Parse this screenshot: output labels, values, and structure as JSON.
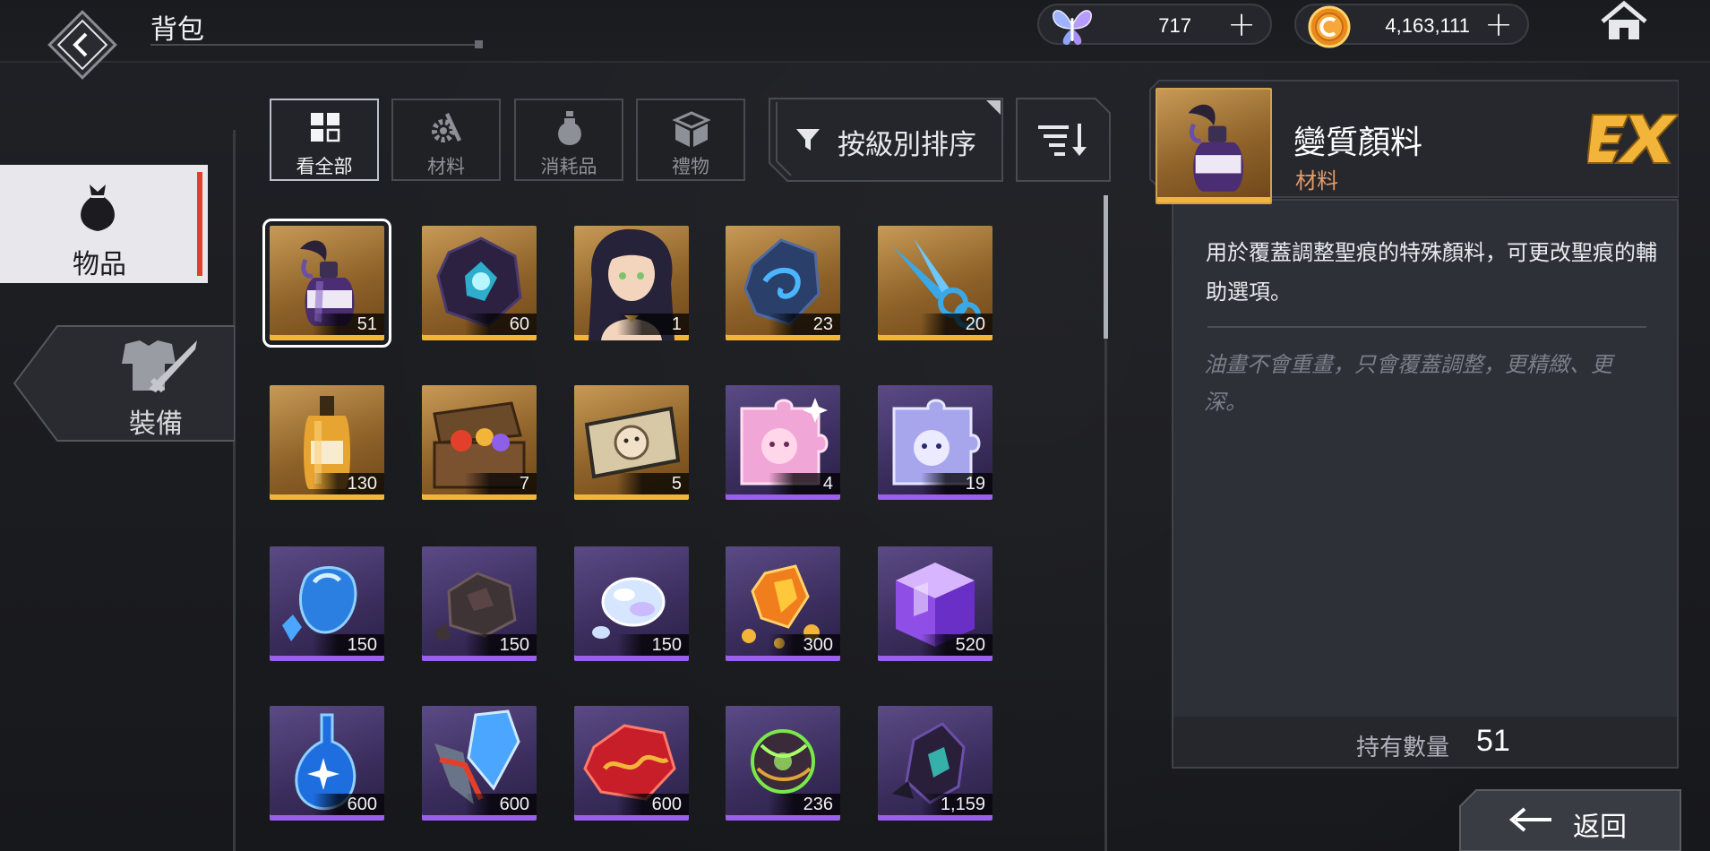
{
  "header": {
    "title": "背包",
    "currencies": [
      {
        "icon": "butterfly-icon",
        "value": "717"
      },
      {
        "icon": "gold-coin-icon",
        "value": "4,163,111"
      }
    ]
  },
  "categories": [
    {
      "label": "物品",
      "icon": "bag-icon",
      "active": true
    },
    {
      "label": "裝備",
      "icon": "armor-sword-icon",
      "active": false
    }
  ],
  "filters": [
    {
      "label": "看全部",
      "icon": "grid-icon",
      "active": true
    },
    {
      "label": "材料",
      "icon": "gear-tools-icon",
      "active": false
    },
    {
      "label": "消耗品",
      "icon": "potion-icon",
      "active": false
    },
    {
      "label": "禮物",
      "icon": "gift-box-icon",
      "active": false
    }
  ],
  "sort": {
    "label": "按級別排序"
  },
  "items": [
    {
      "count": "51",
      "rarity": "gold",
      "art": "ink-bottle"
    },
    {
      "count": "60",
      "rarity": "gold",
      "art": "dark-crystal"
    },
    {
      "count": "1",
      "rarity": "gold",
      "art": "portrait"
    },
    {
      "count": "23",
      "rarity": "gold",
      "art": "blue-stone"
    },
    {
      "count": "20",
      "rarity": "gold",
      "art": "scissors"
    },
    {
      "count": "130",
      "rarity": "gold",
      "art": "perfume"
    },
    {
      "count": "7",
      "rarity": "gold",
      "art": "chest"
    },
    {
      "count": "5",
      "rarity": "gold",
      "art": "ticket"
    },
    {
      "count": "4",
      "rarity": "purple",
      "art": "puzzle-pink"
    },
    {
      "count": "19",
      "rarity": "purple",
      "art": "puzzle-blue"
    },
    {
      "count": "150",
      "rarity": "purple",
      "art": "blue-gem"
    },
    {
      "count": "150",
      "rarity": "purple",
      "art": "ore"
    },
    {
      "count": "150",
      "rarity": "purple",
      "art": "pearl"
    },
    {
      "count": "300",
      "rarity": "purple",
      "art": "amber"
    },
    {
      "count": "520",
      "rarity": "purple",
      "art": "cube"
    },
    {
      "count": "600",
      "rarity": "purple",
      "art": "water-drop"
    },
    {
      "count": "600",
      "rarity": "purple",
      "art": "blue-shard"
    },
    {
      "count": "600",
      "rarity": "purple",
      "art": "red-gem"
    },
    {
      "count": "236",
      "rarity": "purple",
      "art": "green-orb"
    },
    {
      "count": "1,159",
      "rarity": "purple",
      "art": "dark-gem"
    }
  ],
  "detail": {
    "name": "變質顏料",
    "type": "材料",
    "badge": "EX",
    "description": "用於覆蓋調整聖痕的特殊顏料，可更改聖痕的輔助選項。",
    "flavor": "油畫不會重畫，只會覆蓋調整，更精緻、更深。",
    "owned_label": "持有數量",
    "owned_value": "51"
  },
  "footer": {
    "return_label": "返回"
  },
  "colors": {
    "accent_red": "#e2402a",
    "gold_rarity": "#f3b43a",
    "purple_rarity": "#9b5ff0",
    "type_label": "#e49a66"
  }
}
